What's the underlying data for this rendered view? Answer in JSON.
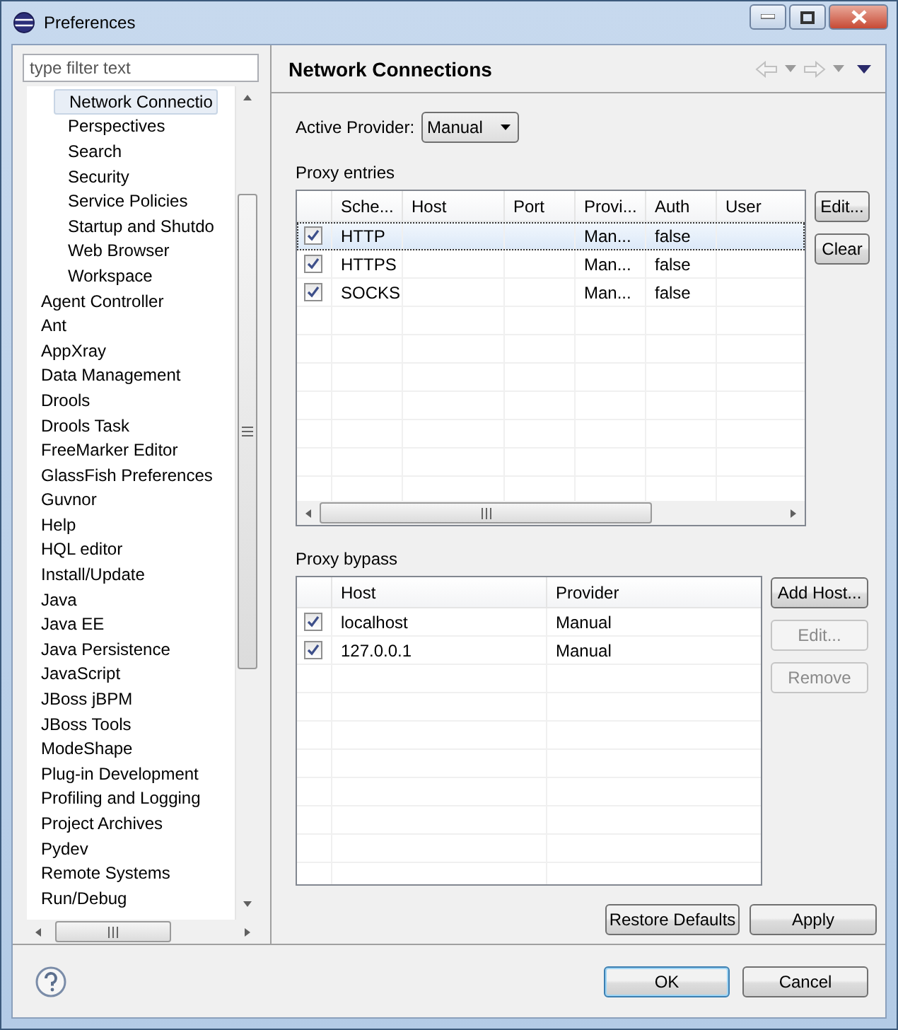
{
  "window": {
    "title": "Preferences"
  },
  "filter": {
    "placeholder": "type filter text"
  },
  "tree": {
    "items": [
      {
        "children": [
          {
            "label": "Network Connectio",
            "selected": true
          },
          {
            "label": "Perspectives",
            "selected": false
          },
          {
            "label": "Search",
            "selected": false
          },
          {
            "label": "Security",
            "selected": false
          },
          {
            "label": "Service Policies",
            "selected": false
          },
          {
            "label": "Startup and Shutdo",
            "selected": false
          },
          {
            "label": "Web Browser",
            "selected": false
          },
          {
            "label": "Workspace",
            "selected": false
          }
        ]
      },
      {
        "label": "Agent Controller",
        "selected": false
      },
      {
        "label": "Ant",
        "selected": false
      },
      {
        "label": "AppXray",
        "selected": false
      },
      {
        "label": "Data Management",
        "selected": false
      },
      {
        "label": "Drools",
        "selected": false
      },
      {
        "label": "Drools Task",
        "selected": false
      },
      {
        "label": "FreeMarker Editor",
        "selected": false
      },
      {
        "label": "GlassFish Preferences",
        "selected": false
      },
      {
        "label": "Guvnor",
        "selected": false
      },
      {
        "label": "Help",
        "selected": false
      },
      {
        "label": "HQL editor",
        "selected": false
      },
      {
        "label": "Install/Update",
        "selected": false
      },
      {
        "label": "Java",
        "selected": false
      },
      {
        "label": "Java EE",
        "selected": false
      },
      {
        "label": "Java Persistence",
        "selected": false
      },
      {
        "label": "JavaScript",
        "selected": false
      },
      {
        "label": "JBoss jBPM",
        "selected": false
      },
      {
        "label": "JBoss Tools",
        "selected": false
      },
      {
        "label": "ModeShape",
        "selected": false
      },
      {
        "label": "Plug-in Development",
        "selected": false
      },
      {
        "label": "Profiling and Logging",
        "selected": false
      },
      {
        "label": "Project Archives",
        "selected": false
      },
      {
        "label": "Pydev",
        "selected": false
      },
      {
        "label": "Remote Systems",
        "selected": false
      },
      {
        "label": "Run/Debug",
        "selected": false
      }
    ]
  },
  "page": {
    "title": "Network Connections",
    "active_provider": {
      "label": "Active Provider:",
      "value": "Manual"
    },
    "proxy_entries": {
      "label": "Proxy entries",
      "columns": [
        "Sche...",
        "Host",
        "Port",
        "Provi...",
        "Auth",
        "User"
      ],
      "rows": [
        {
          "checked": true,
          "selected": true,
          "cells": [
            "HTTP",
            "",
            "",
            "Man...",
            "false",
            ""
          ]
        },
        {
          "checked": true,
          "selected": false,
          "cells": [
            "HTTPS",
            "",
            "",
            "Man...",
            "false",
            ""
          ]
        },
        {
          "checked": true,
          "selected": false,
          "cells": [
            "SOCKS",
            "",
            "",
            "Man...",
            "false",
            ""
          ]
        }
      ],
      "buttons": [
        {
          "label": "Edit...",
          "disabled": false
        },
        {
          "label": "Clear",
          "disabled": false
        }
      ]
    },
    "proxy_bypass": {
      "label": "Proxy bypass",
      "columns": [
        "Host",
        "Provider"
      ],
      "rows": [
        {
          "checked": true,
          "selected": false,
          "cells": [
            "localhost",
            "Manual"
          ]
        },
        {
          "checked": true,
          "selected": false,
          "cells": [
            "127.0.0.1",
            "Manual"
          ]
        }
      ],
      "buttons": [
        {
          "label": "Add Host...",
          "disabled": false
        },
        {
          "label": "Edit...",
          "disabled": true
        },
        {
          "label": "Remove",
          "disabled": true
        }
      ]
    },
    "buttons": [
      {
        "label": "Restore Defaults",
        "disabled": false
      },
      {
        "label": "Apply",
        "disabled": false
      }
    ]
  },
  "dialog_buttons": [
    {
      "label": "OK",
      "default": true
    },
    {
      "label": "Cancel",
      "default": false
    }
  ]
}
